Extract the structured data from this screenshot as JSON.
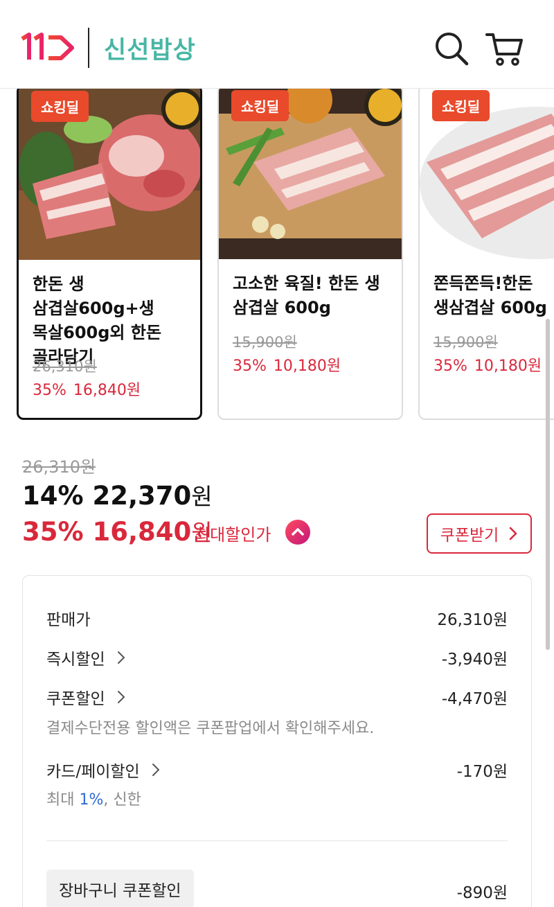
{
  "header": {
    "logo_text": "11",
    "service_name": "신선밥상",
    "colors": {
      "service": "#47b6a4",
      "logo_red": "#ef3a3a",
      "logo_pink": "#e8236c"
    }
  },
  "products": [
    {
      "badge": "쇼킹딜",
      "brand_mark": "한돈",
      "title": "한돈 생 삼겹살600g+생 목살600g외 한돈 골라담기",
      "original_price": "26,310원",
      "discount": "35%",
      "sale_price": "16,840원",
      "selected": true
    },
    {
      "badge": "쇼킹딜",
      "brand_mark": "한돈",
      "title": "고소한 육질! 한돈 생 삼겹살 600g",
      "original_price": "15,900원",
      "discount": "35%",
      "sale_price": "10,180원",
      "selected": false
    },
    {
      "badge": "쇼킹딜",
      "brand_mark": "",
      "title": "쫀득쫀득!한돈 생삼겹살 600g",
      "original_price": "15,900원",
      "discount": "35%",
      "sale_price": "10,180원",
      "selected": false
    }
  ],
  "price": {
    "original": "26,310원",
    "current_discount": "14%",
    "current_amount": "22,370",
    "current_unit": "원",
    "max_discount": "35%",
    "max_amount": "16,840",
    "max_unit": "원",
    "max_label": "최대할인가",
    "coupon_button": "쿠폰받기",
    "accent": "#d9283b"
  },
  "breakdown": {
    "sale_price_label": "판매가",
    "sale_price_value": "26,310원",
    "instant_label": "즉시할인",
    "instant_value": "-3,940원",
    "coupon_label": "쿠폰할인",
    "coupon_value": "-4,470원",
    "coupon_note": "결제수단전용 할인액은 쿠폰팝업에서 확인해주세요.",
    "card_label": "카드/페이할인",
    "card_value": "-170원",
    "card_note_prefix": "최대 ",
    "card_note_highlight": "1%",
    "card_note_suffix": ", 신한",
    "cart_coupon_label": "장바구니 쿠폰할인",
    "cart_coupon_value": "-890원"
  }
}
